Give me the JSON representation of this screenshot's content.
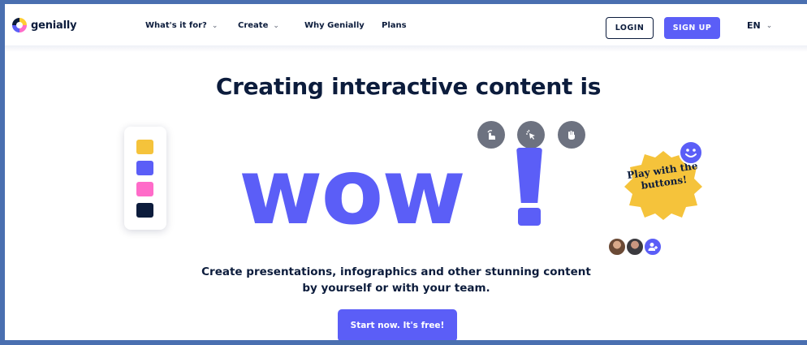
{
  "nav": {
    "brand": "genially",
    "items": [
      {
        "label": "What's it for?",
        "has_dropdown": true
      },
      {
        "label": "Create",
        "has_dropdown": true
      },
      {
        "label": "Why Genially",
        "has_dropdown": false
      },
      {
        "label": "Plans",
        "has_dropdown": false
      }
    ],
    "chevron": "⌄",
    "login_label": "LOGIN",
    "signup_label": "SIGN UP",
    "language": "EN"
  },
  "hero": {
    "headline": "Creating interactive content is",
    "wow_text": "wow",
    "sticker_text": "Play with the buttons!",
    "subtitle": "Create presentations, infographics and other stunning content by yourself or with your team.",
    "cta_label": "Start now. It's free!",
    "palette": {
      "icon": "color-palette",
      "colors": [
        "#f5c33b",
        "#5b5ef7",
        "#ff6bc9",
        "#0c1c3c"
      ]
    },
    "action_buttons": [
      {
        "icon": "pointer-hand-icon"
      },
      {
        "icon": "click-icon"
      },
      {
        "icon": "grab-hand-icon"
      }
    ],
    "avatars": [
      {
        "icon": "avatar-photo-icon"
      },
      {
        "icon": "avatar-photo-icon"
      },
      {
        "icon": "add-user-icon"
      }
    ]
  },
  "colors": {
    "accent": "#5b5ef7",
    "dark": "#0c1c3c",
    "sticker": "#f5c33b",
    "frame_border": "#4a6fb0"
  }
}
